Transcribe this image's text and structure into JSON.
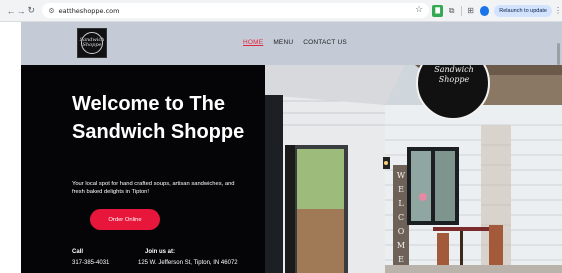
{
  "browser": {
    "url": "eattheshoppe.com",
    "update_label": "Relaunch to update"
  },
  "site": {
    "logo_text": "Sandwich Shoppe",
    "menu": [
      {
        "label": "HOME",
        "active": true
      },
      {
        "label": "MENU",
        "active": false
      },
      {
        "label": "CONTACT US",
        "active": false
      }
    ],
    "hero": {
      "title": "Welcome to The Sandwich Shoppe",
      "description": "Your local spot for hand crafted soups, artisan sandwiches, and fresh baked delights in Tipton!",
      "order_button": "Order Online"
    },
    "contact": {
      "call_label": "Call",
      "phone": "317-385-4031",
      "join_label": "Join us at:",
      "address": "125 W. Jefferson St, Tipton, IN 46072"
    },
    "photo": {
      "sign_text": "Sandwich Shoppe",
      "welcome_letters": "WELCOME"
    }
  },
  "colors": {
    "accent": "#e8163a",
    "header_bg": "#c4cbd6",
    "panel_bg": "#050508"
  }
}
